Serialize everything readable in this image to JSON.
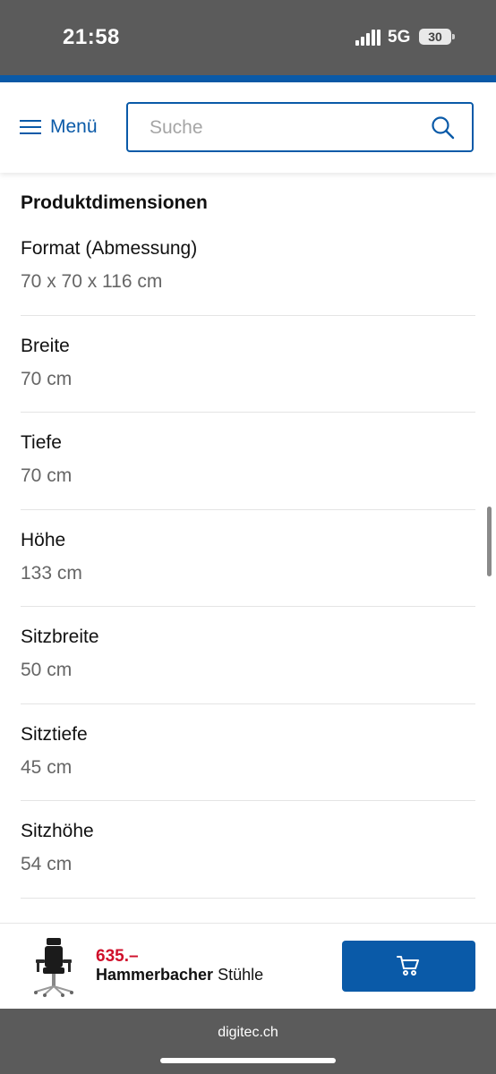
{
  "status_bar": {
    "time": "21:58",
    "network": "5G",
    "battery": "30"
  },
  "header": {
    "menu_label": "Menü",
    "search_placeholder": "Suche"
  },
  "section_title": "Produktdimensionen",
  "specs": [
    {
      "name": "Format (Abmessung)",
      "value": "70 x 70 x 116 cm"
    },
    {
      "name": "Breite",
      "value": "70 cm"
    },
    {
      "name": "Tiefe",
      "value": "70 cm"
    },
    {
      "name": "Höhe",
      "value": "133 cm"
    },
    {
      "name": "Sitzbreite",
      "value": "50 cm"
    },
    {
      "name": "Sitztiefe",
      "value": "45 cm"
    },
    {
      "name": "Sitzhöhe",
      "value": "54 cm"
    }
  ],
  "product_bar": {
    "price": "635.–",
    "brand": "Hammerbacher",
    "category": "Stühle"
  },
  "browser": {
    "domain": "digitec.ch"
  },
  "colors": {
    "accent": "#0a5aa8",
    "price": "#d0102b",
    "chrome": "#5b5b5b"
  }
}
